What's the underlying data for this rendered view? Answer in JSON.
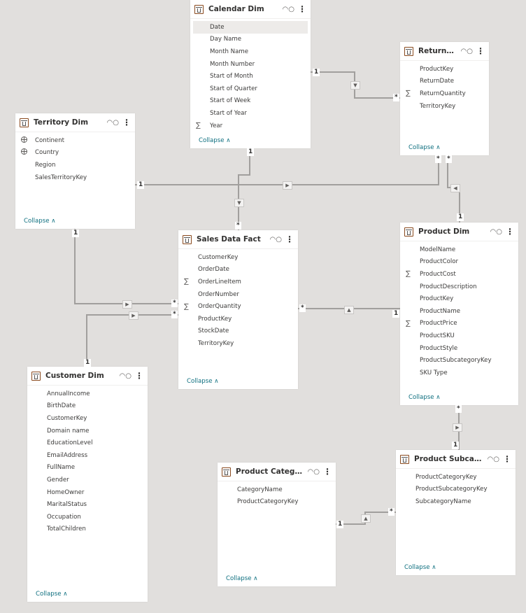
{
  "canvas": {
    "background": "#e1dfdd",
    "accent": "#0e6f7f",
    "table_icon_color": "#8a4a1e"
  },
  "collapse_label": "Collapse",
  "tables": [
    {
      "id": "calendar",
      "name": "Calendar Dim",
      "fields": [
        {
          "name": "Date",
          "icon": "",
          "selected": true
        },
        {
          "name": "Day Name",
          "icon": ""
        },
        {
          "name": "Month Name",
          "icon": ""
        },
        {
          "name": "Month Number",
          "icon": ""
        },
        {
          "name": "Start of Month",
          "icon": ""
        },
        {
          "name": "Start of Quarter",
          "icon": ""
        },
        {
          "name": "Start of Week",
          "icon": ""
        },
        {
          "name": "Start of Year",
          "icon": ""
        },
        {
          "name": "Year",
          "icon": "sigma"
        }
      ]
    },
    {
      "id": "returns",
      "name": "Returns Data",
      "fields": [
        {
          "name": "ProductKey",
          "icon": ""
        },
        {
          "name": "ReturnDate",
          "icon": ""
        },
        {
          "name": "ReturnQuantity",
          "icon": "sigma"
        },
        {
          "name": "TerritoryKey",
          "icon": ""
        }
      ]
    },
    {
      "id": "territory",
      "name": "Territory Dim",
      "fields": [
        {
          "name": "Continent",
          "icon": "globe"
        },
        {
          "name": "Country",
          "icon": "globe"
        },
        {
          "name": "Region",
          "icon": ""
        },
        {
          "name": "SalesTerritoryKey",
          "icon": ""
        }
      ]
    },
    {
      "id": "sales",
      "name": "Sales Data Fact",
      "fields": [
        {
          "name": "CustomerKey",
          "icon": ""
        },
        {
          "name": "OrderDate",
          "icon": ""
        },
        {
          "name": "OrderLineItem",
          "icon": "sigma"
        },
        {
          "name": "OrderNumber",
          "icon": ""
        },
        {
          "name": "OrderQuantity",
          "icon": "sigma"
        },
        {
          "name": "ProductKey",
          "icon": ""
        },
        {
          "name": "StockDate",
          "icon": ""
        },
        {
          "name": "TerritoryKey",
          "icon": ""
        }
      ]
    },
    {
      "id": "product",
      "name": "Product Dim",
      "fields": [
        {
          "name": "ModelName",
          "icon": ""
        },
        {
          "name": "ProductColor",
          "icon": ""
        },
        {
          "name": "ProductCost",
          "icon": "sigma"
        },
        {
          "name": "ProductDescription",
          "icon": ""
        },
        {
          "name": "ProductKey",
          "icon": ""
        },
        {
          "name": "ProductName",
          "icon": ""
        },
        {
          "name": "ProductPrice",
          "icon": "sigma"
        },
        {
          "name": "ProductSKU",
          "icon": ""
        },
        {
          "name": "ProductStyle",
          "icon": ""
        },
        {
          "name": "ProductSubcategoryKey",
          "icon": ""
        },
        {
          "name": "SKU Type",
          "icon": ""
        }
      ]
    },
    {
      "id": "customer",
      "name": "Customer Dim",
      "fields": [
        {
          "name": "AnnualIncome",
          "icon": ""
        },
        {
          "name": "BirthDate",
          "icon": ""
        },
        {
          "name": "CustomerKey",
          "icon": ""
        },
        {
          "name": "Domain name",
          "icon": ""
        },
        {
          "name": "EducationLevel",
          "icon": ""
        },
        {
          "name": "EmailAddress",
          "icon": ""
        },
        {
          "name": "FullName",
          "icon": ""
        },
        {
          "name": "Gender",
          "icon": ""
        },
        {
          "name": "HomeOwner",
          "icon": ""
        },
        {
          "name": "MaritalStatus",
          "icon": ""
        },
        {
          "name": "Occupation",
          "icon": ""
        },
        {
          "name": "TotalChildren",
          "icon": ""
        }
      ]
    },
    {
      "id": "categories",
      "name": "Product Categories D...",
      "fields": [
        {
          "name": "CategoryName",
          "icon": ""
        },
        {
          "name": "ProductCategoryKey",
          "icon": ""
        }
      ]
    },
    {
      "id": "subcategories",
      "name": "Product Subcategorie...",
      "fields": [
        {
          "name": "ProductCategoryKey",
          "icon": ""
        },
        {
          "name": "ProductSubcategoryKey",
          "icon": ""
        },
        {
          "name": "SubcategoryName",
          "icon": ""
        }
      ]
    }
  ],
  "relationships": [
    {
      "from": "calendar",
      "to": "returns",
      "from_card": "1",
      "to_card": "*"
    },
    {
      "from": "territory",
      "to": "returns",
      "from_card": "1",
      "to_card": "*"
    },
    {
      "from": "product",
      "to": "returns",
      "from_card": "1",
      "to_card": "*"
    },
    {
      "from": "calendar",
      "to": "sales",
      "from_card": "1",
      "to_card": "*"
    },
    {
      "from": "territory",
      "to": "sales",
      "from_card": "1",
      "to_card": "*"
    },
    {
      "from": "customer",
      "to": "sales",
      "from_card": "1",
      "to_card": "*"
    },
    {
      "from": "product",
      "to": "sales",
      "from_card": "1",
      "to_card": "*"
    },
    {
      "from": "subcategories",
      "to": "product",
      "from_card": "1",
      "to_card": "*"
    },
    {
      "from": "categories",
      "to": "subcategories",
      "from_card": "1",
      "to_card": "*"
    }
  ]
}
